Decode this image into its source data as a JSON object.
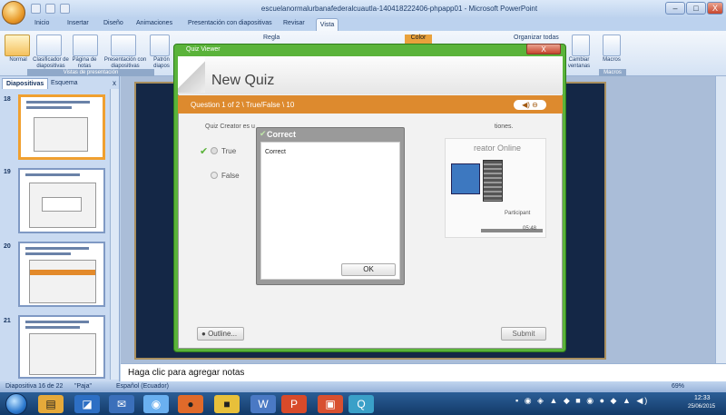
{
  "window": {
    "title": "escuelanormalurbanafederalcuautla-140418222406-phpapp01 - Microsoft PowerPoint",
    "min": "–",
    "max": "□",
    "close": "X"
  },
  "tabs": [
    "Inicio",
    "Insertar",
    "Diseño",
    "Animaciones",
    "Presentación con diapositivas",
    "Revisar",
    "Vista"
  ],
  "ribbon": {
    "buttons": [
      "Normal",
      "Clasificador de diapositivas",
      "Página de notas",
      "Presentación con diapositivas",
      "Patrón diapos"
    ],
    "regla": "Regla",
    "color": "Color",
    "organizar": "Organizar todas",
    "cambiar": "Cambiar ventanas",
    "macros": "Macros",
    "group_label": "Vistas de presentación",
    "macros_group": "Macros"
  },
  "panel": {
    "tab_diapositivas": "Diapositivas",
    "tab_esquema": "Esquema",
    "close": "x",
    "slides": [
      "18",
      "19",
      "20",
      "21"
    ]
  },
  "quiz": {
    "window_title": "Quiz Viewer",
    "heading": "New Quiz",
    "progress": "Question 1 of 2 \\ True/False \\ 10",
    "sound": "◀) ⊖",
    "question": "Quiz Creator es u",
    "question_tail": "tiones.",
    "option_true": "True",
    "option_false": "False",
    "panel_title": "reator Online",
    "participant": "Participant",
    "time": "05:48",
    "outline_btn": "Outline...",
    "submit_btn": "Submit"
  },
  "dialog": {
    "title": "Correct",
    "message": "Correct",
    "ok": "OK"
  },
  "notes": "Haga clic para agregar notas",
  "status": {
    "slide": "Diapositiva 16 de 22",
    "theme": "\"Paja\"",
    "lang": "Español (Ecuador)",
    "zoom": "69%"
  },
  "clock": {
    "time": "12:33",
    "date": "25/06/2015"
  }
}
